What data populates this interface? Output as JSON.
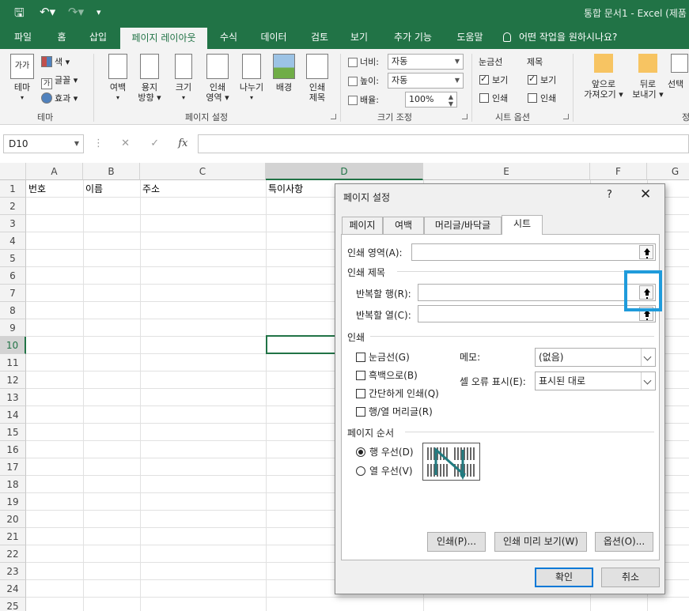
{
  "window": {
    "title": "통합 문서1 - Excel (제품"
  },
  "ribbon_tabs": [
    "파일",
    "홈",
    "삽입",
    "페이지 레이아웃",
    "수식",
    "데이터",
    "검토",
    "보기",
    "추가 기능",
    "도움말"
  ],
  "tell_me": "어떤 작업을 원하시나요?",
  "ribbon": {
    "theme_group": {
      "theme_btn": "테마",
      "colors": "색",
      "fonts": "글꼴",
      "effects": "효과",
      "label": "테마",
      "theme_icon_text": "가가"
    },
    "page_setup_group": {
      "margins": "여백",
      "orientation_1": "용지",
      "orientation_2": "방향",
      "size": "크기",
      "print_area_1": "인쇄",
      "print_area_2": "영역",
      "breaks": "나누기",
      "background": "배경",
      "print_titles_1": "인쇄",
      "print_titles_2": "제목",
      "label": "페이지 설정"
    },
    "scale_group": {
      "width_label": "너비:",
      "width_value": "자동",
      "height_label": "높이:",
      "height_value": "자동",
      "scale_label": "배율:",
      "scale_value": "100%",
      "label": "크기 조정"
    },
    "sheet_options_group": {
      "gridlines": "눈금선",
      "headings": "제목",
      "view1": "보기",
      "print1": "인쇄",
      "view2": "보기",
      "print2": "인쇄",
      "label": "시트 옵션"
    },
    "arrange_group": {
      "bring_forward_1": "앞으로",
      "bring_forward_2": "가져오기",
      "send_backward_1": "뒤로",
      "send_backward_2": "보내기",
      "selection": "선택",
      "label_partial": "정"
    }
  },
  "formula_bar": {
    "name_box": "D10",
    "fx": "fx"
  },
  "grid": {
    "columns": [
      "A",
      "B",
      "C",
      "D",
      "E",
      "F",
      "G"
    ],
    "rows": [
      "1",
      "2",
      "3",
      "4",
      "5",
      "6",
      "7",
      "8",
      "9",
      "10",
      "11",
      "12",
      "13",
      "14",
      "15",
      "16",
      "17",
      "18",
      "19",
      "20",
      "21",
      "22",
      "23",
      "24",
      "25"
    ],
    "row1": [
      "번호",
      "이름",
      "주소",
      "특이사항"
    ],
    "active_cell": "D10"
  },
  "dialog": {
    "title": "페이지 설정",
    "help": "?",
    "close": "✕",
    "tabs": [
      "페이지",
      "여백",
      "머리글/바닥글",
      "시트"
    ],
    "active_tab": "시트",
    "print_area_label": "인쇄 영역(A):",
    "print_titles_section": "인쇄 제목",
    "rows_repeat_label": "반복할 행(R):",
    "cols_repeat_label": "반복할 열(C):",
    "print_section": "인쇄",
    "checks": [
      "눈금선(G)",
      "흑백으로(B)",
      "간단하게 인쇄(Q)",
      "행/열 머리글(R)"
    ],
    "comments_label": "메모:",
    "comments_value": "(없음)",
    "errors_label": "셀 오류 표시(E):",
    "errors_value": "표시된 대로",
    "page_order_section": "페이지 순서",
    "order_options": [
      "행 우선(D)",
      "열 우선(V)"
    ],
    "order_selected": "행 우선(D)",
    "buttons": {
      "print": "인쇄(P)...",
      "preview": "인쇄 미리 보기(W)",
      "options": "옵션(O)...",
      "ok": "확인",
      "cancel": "취소"
    },
    "highlight_color": "#1f9bdb"
  },
  "colors": {
    "excel_green": "#217346",
    "ribbon_bg": "#f3f3f3"
  }
}
